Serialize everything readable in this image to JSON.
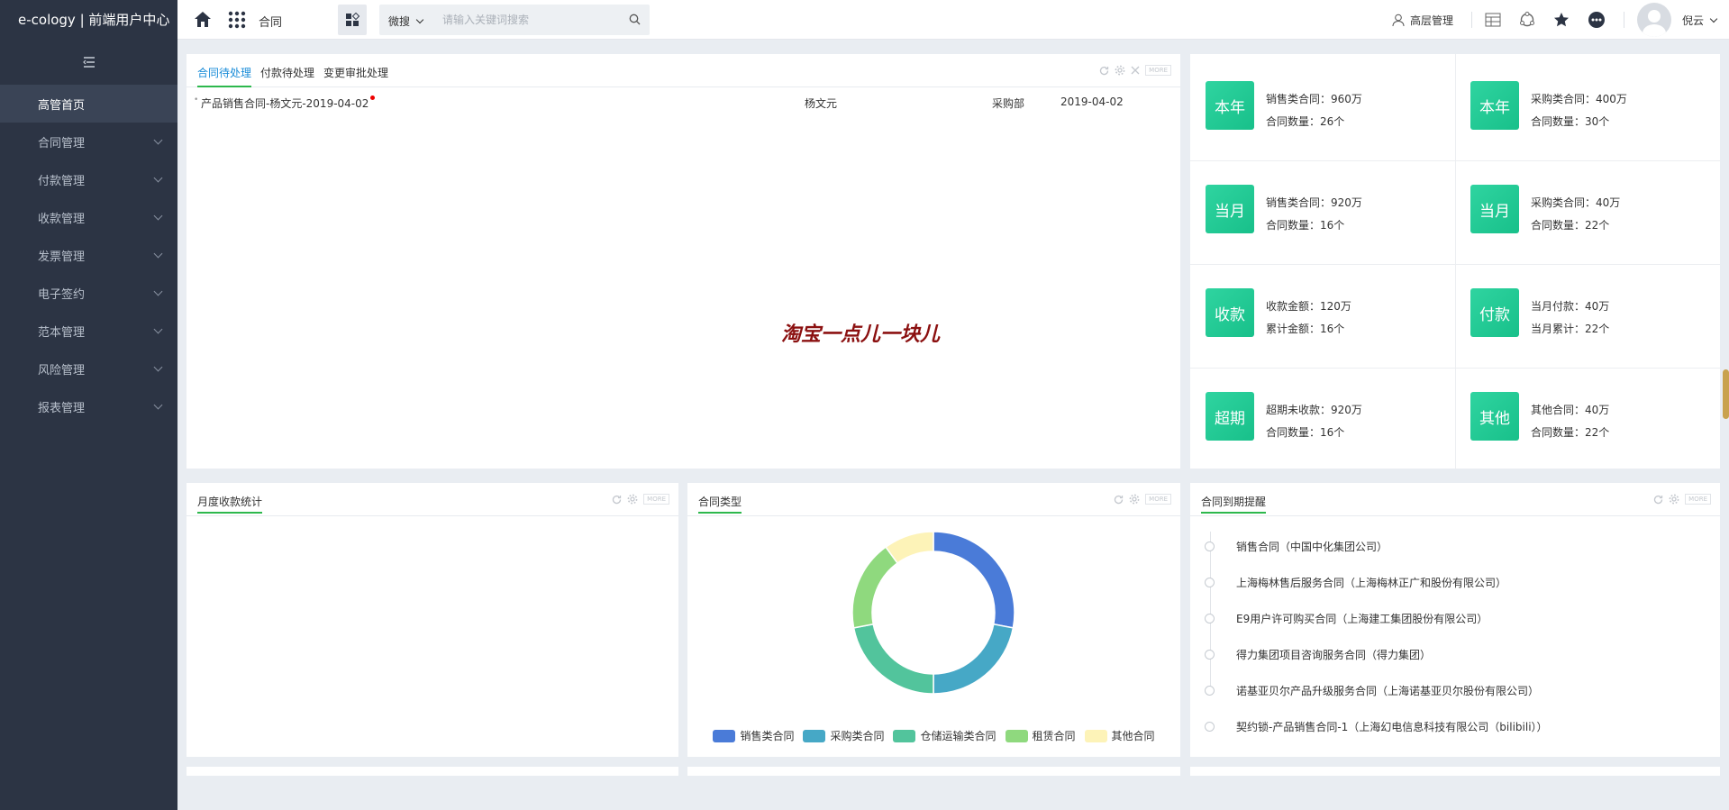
{
  "brand": "e-cology | 前端用户中心",
  "sidebar": {
    "items": [
      {
        "label": "高管首页",
        "active": true
      },
      {
        "label": "合同管理"
      },
      {
        "label": "付款管理"
      },
      {
        "label": "收款管理"
      },
      {
        "label": "发票管理"
      },
      {
        "label": "电子签约"
      },
      {
        "label": "范本管理"
      },
      {
        "label": "风险管理"
      },
      {
        "label": "报表管理"
      }
    ]
  },
  "header": {
    "module": "合同",
    "search_scope": "微搜",
    "search_placeholder": "请输入关键词搜索",
    "mgmt_label": "高层管理",
    "user_name": "倪云"
  },
  "todo": {
    "tabs": [
      "合同待处理",
      "付款待处理",
      "变更审批处理"
    ],
    "more": "MORE",
    "rows": [
      {
        "title": "产品销售合同-杨文元-2019-04-02",
        "person": "杨文元",
        "dept": "采购部",
        "date": "2019-04-02"
      }
    ],
    "watermark": "淘宝一点儿一块儿"
  },
  "stats": [
    {
      "badge": "本年",
      "line1": "销售类合同：960万",
      "line2": "合同数量：26个"
    },
    {
      "badge": "本年",
      "line1": "采购类合同：400万",
      "line2": "合同数量：30个"
    },
    {
      "badge": "当月",
      "line1": "销售类合同：920万",
      "line2": "合同数量：16个"
    },
    {
      "badge": "当月",
      "line1": "采购类合同：40万",
      "line2": "合同数量：22个"
    },
    {
      "badge": "收款",
      "line1": "收款金额：120万",
      "line2": "累计金额：16个"
    },
    {
      "badge": "付款",
      "line1": "当月付款：40万",
      "line2": "当月累计：22个"
    },
    {
      "badge": "超期",
      "line1": "超期未收款：920万",
      "line2": "合同数量：16个"
    },
    {
      "badge": "其他",
      "line1": "其他合同：40万",
      "line2": "合同数量：22个"
    }
  ],
  "monthly": {
    "title": "月度收款统计",
    "more": "MORE"
  },
  "contract_type": {
    "title": "合同类型",
    "more": "MORE"
  },
  "expiry": {
    "title": "合同到期提醒",
    "more": "MORE",
    "items": [
      "销售合同（中国中化集团公司）",
      "上海梅林售后服务合同（上海梅林正广和股份有限公司）",
      "E9用户许可购买合同（上海建工集团股份有限公司）",
      "得力集团项目咨询服务合同（得力集团）",
      "诺基亚贝尔产品升级服务合同（上海诺基亚贝尔股份有限公司）",
      "契约锁-产品销售合同-1（上海幻电信息科技有限公司（bilibili））"
    ]
  },
  "chart_data": {
    "type": "pie",
    "donut": true,
    "categories": [
      "销售类合同",
      "采购类合同",
      "仓储运输类合同",
      "租赁合同",
      "其他合同"
    ],
    "values": [
      28,
      22,
      22,
      18,
      10
    ],
    "colors": [
      "#4a7bd8",
      "#46a8c6",
      "#52c49c",
      "#8fd97e",
      "#fdf3b8"
    ],
    "legend": "bottom"
  }
}
